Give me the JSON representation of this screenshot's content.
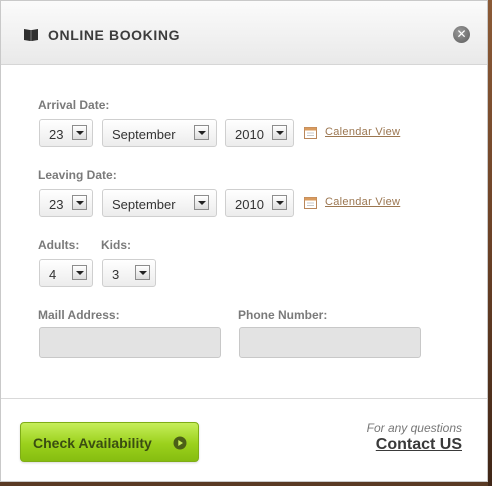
{
  "modal": {
    "title": "ONLINE BOOKING",
    "close_glyph": "✕"
  },
  "form": {
    "arrival": {
      "label": "Arrival Date:",
      "day": "23",
      "month": "September",
      "year": "2010",
      "calendar_link": "Calendar View"
    },
    "leaving": {
      "label": "Leaving Date:",
      "day": "23",
      "month": "September",
      "year": "2010",
      "calendar_link": "Calendar View"
    },
    "adults": {
      "label": "Adults:",
      "value": "4"
    },
    "kids": {
      "label": "Kids:",
      "value": "3"
    },
    "mail": {
      "label": "Maill Address:",
      "value": ""
    },
    "phone": {
      "label": "Phone Number:",
      "value": ""
    }
  },
  "footer": {
    "check_button": "Check Availability",
    "questions_note": "For any questions",
    "contact_link": "Contact US"
  },
  "icons": {
    "header": "book-icon",
    "close": "close-icon",
    "calendar": "calendar-icon",
    "button": "play-circle-icon"
  },
  "colors": {
    "accent_green": "#9bd11c",
    "link_brown": "#9b7650",
    "label_gray": "#7a7a7a"
  }
}
